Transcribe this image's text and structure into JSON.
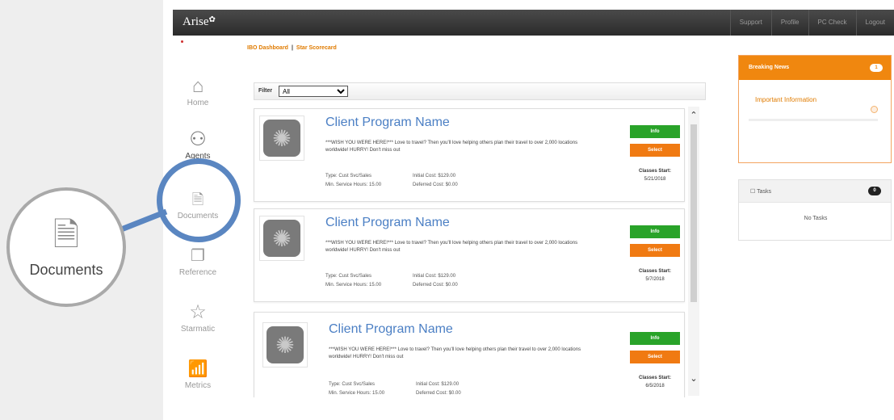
{
  "app": {
    "logo": "Arise",
    "logo_mark": "✿"
  },
  "topnav": [
    "Support",
    "Profile",
    "PC Check",
    "Logout"
  ],
  "breadcrumb": {
    "first": "IBO Dashboard",
    "separator": "|",
    "second": "Star Scorecard"
  },
  "sidebar": {
    "items": [
      {
        "label": "Home",
        "icon": "home-icon",
        "glyph": "⌂"
      },
      {
        "label": "Agents",
        "icon": "agent-icon",
        "glyph": "⚇"
      },
      {
        "label": "Documents",
        "icon": "document-icon",
        "glyph": "🗎"
      },
      {
        "label": "Reference",
        "icon": "reference-icon",
        "glyph": "❐"
      },
      {
        "label": "Starmatic",
        "icon": "star-icon",
        "glyph": "☆"
      },
      {
        "label": "Metrics",
        "icon": "metrics-icon",
        "glyph": "📶"
      }
    ]
  },
  "filter": {
    "label": "Filter",
    "selected": "All"
  },
  "programs": [
    {
      "title": "Client Program Name",
      "description": "***WISH YOU WERE HERE!*** Love to travel? Then you'll love helping others plan their travel to over 2,000 locations worldwide! HURRY! Don't miss out",
      "type": "Type: Cust Svc/Sales",
      "initial_cost": "Initial Cost: $129.00",
      "min_hours": "Min. Service Hours: 15.00",
      "deferred_cost": "Deferred Cost: $0.00",
      "info_label": "Info",
      "select_label": "Select",
      "classes_label": "Classes Start:",
      "classes_date": "5/21/2018"
    },
    {
      "title": "Client Program Name",
      "description": "***WISH YOU WERE HERE!*** Love to travel? Then you'll love helping others plan their travel to over 2,000 locations worldwide! HURRY! Don't miss out",
      "type": "Type: Cust Svc/Sales",
      "initial_cost": "Initial Cost: $129.00",
      "min_hours": "Min. Service Hours: 15.00",
      "deferred_cost": "Deferred Cost: $0.00",
      "info_label": "Info",
      "select_label": "Select",
      "classes_label": "Classes Start:",
      "classes_date": "5/7/2018"
    },
    {
      "title": "Client Program Name",
      "description": "***WISH YOU WERE HERE!*** Love to travel? Then you'll love helping others plan their travel to over 2,000 locations worldwide! HURRY! Don't miss out",
      "type": "Type: Cust Svc/Sales",
      "initial_cost": "Initial Cost: $129.00",
      "min_hours": "Min. Service Hours: 15.00",
      "deferred_cost": "Deferred Cost: $0.00",
      "info_label": "Info",
      "select_label": "Select",
      "classes_label": "Classes Start:",
      "classes_date": "6/5/2018"
    }
  ],
  "scroll": {
    "up": "⌃",
    "down": "⌄"
  },
  "breaking_news": {
    "title": "Breaking News",
    "count": "1",
    "item": "Important Information"
  },
  "tasks": {
    "title": "Tasks",
    "count": "0",
    "empty": "No Tasks"
  },
  "callout": {
    "label": "Documents",
    "icon": "document-icon",
    "glyph": "🗎"
  },
  "colors": {
    "accent_orange": "#f0870f",
    "info_green": "#29a329",
    "link_blue": "#4b7fc4",
    "callout_blue": "#5a86c1"
  }
}
